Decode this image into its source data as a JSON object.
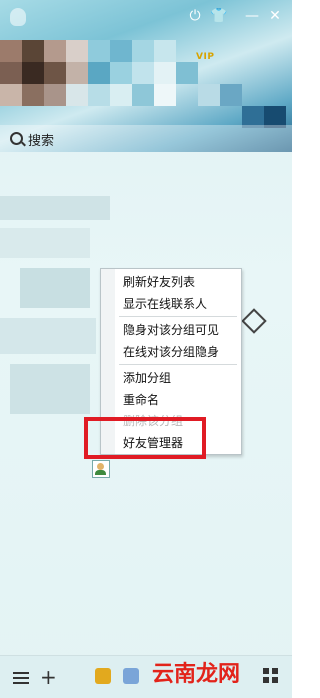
{
  "window": {
    "close_glyph": "✕",
    "minimize_glyph": "—",
    "skin_glyph": "👕",
    "badge_text": "VIP"
  },
  "search": {
    "text": "搜索"
  },
  "context_menu": {
    "items": [
      {
        "label": "刷新好友列表"
      },
      {
        "label": "显示在线联系人"
      },
      {
        "label": "隐身对该分组可见"
      },
      {
        "label": "在线对该分组隐身"
      },
      {
        "label": "添加分组"
      },
      {
        "label": "重命名"
      },
      {
        "label": "删除该分组"
      },
      {
        "label": "好友管理器"
      }
    ]
  },
  "bottom_bar": {
    "add_glyph": "+",
    "watermark": "云南龙网"
  },
  "colors": {
    "highlight_border": "#e01b24",
    "watermark": "#e2231a"
  }
}
